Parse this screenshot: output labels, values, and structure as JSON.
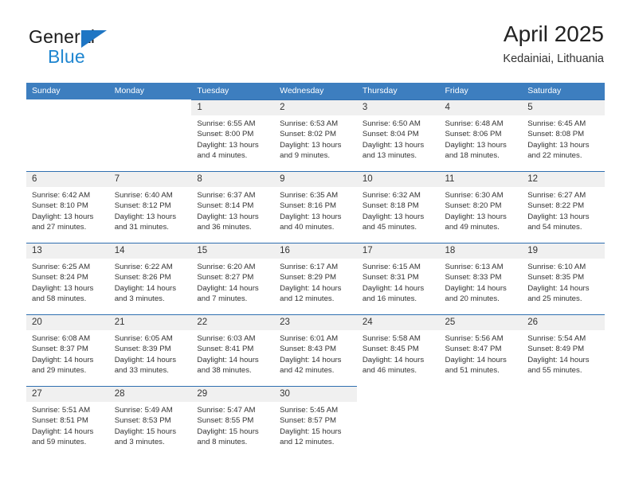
{
  "brand": {
    "name_top": "General",
    "name_bottom": "Blue",
    "accent_color": "#1f76c4",
    "logo_icon": "triangle-flag-icon"
  },
  "header": {
    "title": "April 2025",
    "subtitle": "Kedainiai, Lithuania"
  },
  "colors": {
    "header_row_bg": "#3d7ebf",
    "row_divider": "#2f6fb0",
    "daynum_band_bg": "#f0f0f0",
    "text": "#333333"
  },
  "calendar": {
    "day_names": [
      "Sunday",
      "Monday",
      "Tuesday",
      "Wednesday",
      "Thursday",
      "Friday",
      "Saturday"
    ],
    "weeks": [
      [
        {
          "day": "",
          "lines": []
        },
        {
          "day": "",
          "lines": []
        },
        {
          "day": "1",
          "lines": [
            "Sunrise: 6:55 AM",
            "Sunset: 8:00 PM",
            "Daylight: 13 hours",
            "and 4 minutes."
          ]
        },
        {
          "day": "2",
          "lines": [
            "Sunrise: 6:53 AM",
            "Sunset: 8:02 PM",
            "Daylight: 13 hours",
            "and 9 minutes."
          ]
        },
        {
          "day": "3",
          "lines": [
            "Sunrise: 6:50 AM",
            "Sunset: 8:04 PM",
            "Daylight: 13 hours",
            "and 13 minutes."
          ]
        },
        {
          "day": "4",
          "lines": [
            "Sunrise: 6:48 AM",
            "Sunset: 8:06 PM",
            "Daylight: 13 hours",
            "and 18 minutes."
          ]
        },
        {
          "day": "5",
          "lines": [
            "Sunrise: 6:45 AM",
            "Sunset: 8:08 PM",
            "Daylight: 13 hours",
            "and 22 minutes."
          ]
        }
      ],
      [
        {
          "day": "6",
          "lines": [
            "Sunrise: 6:42 AM",
            "Sunset: 8:10 PM",
            "Daylight: 13 hours",
            "and 27 minutes."
          ]
        },
        {
          "day": "7",
          "lines": [
            "Sunrise: 6:40 AM",
            "Sunset: 8:12 PM",
            "Daylight: 13 hours",
            "and 31 minutes."
          ]
        },
        {
          "day": "8",
          "lines": [
            "Sunrise: 6:37 AM",
            "Sunset: 8:14 PM",
            "Daylight: 13 hours",
            "and 36 minutes."
          ]
        },
        {
          "day": "9",
          "lines": [
            "Sunrise: 6:35 AM",
            "Sunset: 8:16 PM",
            "Daylight: 13 hours",
            "and 40 minutes."
          ]
        },
        {
          "day": "10",
          "lines": [
            "Sunrise: 6:32 AM",
            "Sunset: 8:18 PM",
            "Daylight: 13 hours",
            "and 45 minutes."
          ]
        },
        {
          "day": "11",
          "lines": [
            "Sunrise: 6:30 AM",
            "Sunset: 8:20 PM",
            "Daylight: 13 hours",
            "and 49 minutes."
          ]
        },
        {
          "day": "12",
          "lines": [
            "Sunrise: 6:27 AM",
            "Sunset: 8:22 PM",
            "Daylight: 13 hours",
            "and 54 minutes."
          ]
        }
      ],
      [
        {
          "day": "13",
          "lines": [
            "Sunrise: 6:25 AM",
            "Sunset: 8:24 PM",
            "Daylight: 13 hours",
            "and 58 minutes."
          ]
        },
        {
          "day": "14",
          "lines": [
            "Sunrise: 6:22 AM",
            "Sunset: 8:26 PM",
            "Daylight: 14 hours",
            "and 3 minutes."
          ]
        },
        {
          "day": "15",
          "lines": [
            "Sunrise: 6:20 AM",
            "Sunset: 8:27 PM",
            "Daylight: 14 hours",
            "and 7 minutes."
          ]
        },
        {
          "day": "16",
          "lines": [
            "Sunrise: 6:17 AM",
            "Sunset: 8:29 PM",
            "Daylight: 14 hours",
            "and 12 minutes."
          ]
        },
        {
          "day": "17",
          "lines": [
            "Sunrise: 6:15 AM",
            "Sunset: 8:31 PM",
            "Daylight: 14 hours",
            "and 16 minutes."
          ]
        },
        {
          "day": "18",
          "lines": [
            "Sunrise: 6:13 AM",
            "Sunset: 8:33 PM",
            "Daylight: 14 hours",
            "and 20 minutes."
          ]
        },
        {
          "day": "19",
          "lines": [
            "Sunrise: 6:10 AM",
            "Sunset: 8:35 PM",
            "Daylight: 14 hours",
            "and 25 minutes."
          ]
        }
      ],
      [
        {
          "day": "20",
          "lines": [
            "Sunrise: 6:08 AM",
            "Sunset: 8:37 PM",
            "Daylight: 14 hours",
            "and 29 minutes."
          ]
        },
        {
          "day": "21",
          "lines": [
            "Sunrise: 6:05 AM",
            "Sunset: 8:39 PM",
            "Daylight: 14 hours",
            "and 33 minutes."
          ]
        },
        {
          "day": "22",
          "lines": [
            "Sunrise: 6:03 AM",
            "Sunset: 8:41 PM",
            "Daylight: 14 hours",
            "and 38 minutes."
          ]
        },
        {
          "day": "23",
          "lines": [
            "Sunrise: 6:01 AM",
            "Sunset: 8:43 PM",
            "Daylight: 14 hours",
            "and 42 minutes."
          ]
        },
        {
          "day": "24",
          "lines": [
            "Sunrise: 5:58 AM",
            "Sunset: 8:45 PM",
            "Daylight: 14 hours",
            "and 46 minutes."
          ]
        },
        {
          "day": "25",
          "lines": [
            "Sunrise: 5:56 AM",
            "Sunset: 8:47 PM",
            "Daylight: 14 hours",
            "and 51 minutes."
          ]
        },
        {
          "day": "26",
          "lines": [
            "Sunrise: 5:54 AM",
            "Sunset: 8:49 PM",
            "Daylight: 14 hours",
            "and 55 minutes."
          ]
        }
      ],
      [
        {
          "day": "27",
          "lines": [
            "Sunrise: 5:51 AM",
            "Sunset: 8:51 PM",
            "Daylight: 14 hours",
            "and 59 minutes."
          ]
        },
        {
          "day": "28",
          "lines": [
            "Sunrise: 5:49 AM",
            "Sunset: 8:53 PM",
            "Daylight: 15 hours",
            "and 3 minutes."
          ]
        },
        {
          "day": "29",
          "lines": [
            "Sunrise: 5:47 AM",
            "Sunset: 8:55 PM",
            "Daylight: 15 hours",
            "and 8 minutes."
          ]
        },
        {
          "day": "30",
          "lines": [
            "Sunrise: 5:45 AM",
            "Sunset: 8:57 PM",
            "Daylight: 15 hours",
            "and 12 minutes."
          ]
        },
        {
          "day": "",
          "lines": []
        },
        {
          "day": "",
          "lines": []
        },
        {
          "day": "",
          "lines": []
        }
      ]
    ]
  }
}
